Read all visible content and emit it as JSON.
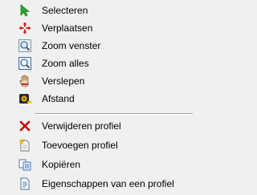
{
  "menu": {
    "items": [
      {
        "label": "Selecteren",
        "icon": "select-arrow-icon"
      },
      {
        "label": "Verplaatsen",
        "icon": "move-arrows-icon"
      },
      {
        "label": "Zoom venster",
        "icon": "zoom-window-icon"
      },
      {
        "label": "Zoom alles",
        "icon": "zoom-all-icon"
      },
      {
        "label": "Verslepen",
        "icon": "hand-drag-icon"
      },
      {
        "label": "Afstand",
        "icon": "measure-tape-icon"
      },
      {
        "label": "Verwijderen profiel",
        "icon": "delete-x-icon"
      },
      {
        "label": "Toevoegen profiel",
        "icon": "add-document-icon"
      },
      {
        "label": "Kopiëren",
        "icon": "copy-icon"
      },
      {
        "label": "Eigenschappen van een profiel",
        "icon": "properties-icon"
      }
    ]
  },
  "colors": {
    "background": "#f0f0f0",
    "select_green": "#2fa52f",
    "move_red": "#d11f1f",
    "delete_red": "#cc0000",
    "separator": "#a0a0a0"
  }
}
